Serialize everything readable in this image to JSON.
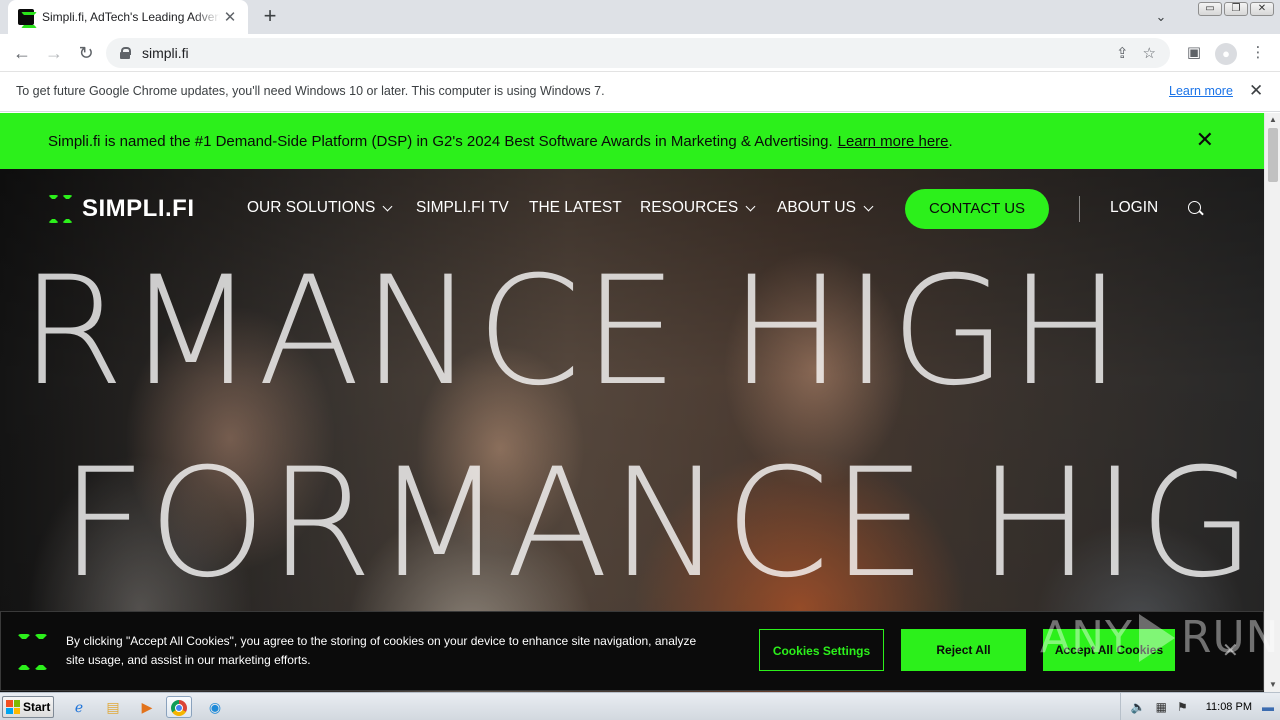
{
  "browser": {
    "tab_title": "Simpli.fi, AdTech's Leading Advertising Platform",
    "tab_close": "✕",
    "new_tab": "+",
    "tab_search": "⌄",
    "url": "simpli.fi",
    "window_controls": [
      "▭",
      "❐",
      "✕"
    ]
  },
  "infobar": {
    "message": "To get future Google Chrome updates, you'll need Windows 10 or later. This computer is using Windows 7.",
    "link": "Learn more",
    "close": "✕"
  },
  "promo": {
    "text": "Simpli.fi is named the #1 Demand-Side Platform (DSP) in G2's 2024 Best Software Awards in Marketing & Advertising.",
    "link": "Learn more here",
    "trailing": ".",
    "close": "✕"
  },
  "site_nav": {
    "logo_text": "SIMPLI.FI",
    "items": [
      {
        "label": "OUR SOLUTIONS",
        "has_dropdown": true
      },
      {
        "label": "SIMPLI.FI TV",
        "has_dropdown": false
      },
      {
        "label": "THE LATEST",
        "has_dropdown": false
      },
      {
        "label": "RESOURCES",
        "has_dropdown": true
      },
      {
        "label": "ABOUT US",
        "has_dropdown": true
      }
    ],
    "contact_label": "CONTACT US",
    "login_label": "LOGIN"
  },
  "hero": {
    "line1": "RMANCE HIGH",
    "line2": "FORMANCE HIG"
  },
  "cookie": {
    "text": "By clicking \"Accept All Cookies\", you agree to the storing of cookies on your device to enhance site navigation, analyze site usage, and assist in our marketing efforts.",
    "settings_label": "Cookies Settings",
    "reject_label": "Reject All",
    "accept_label": "Accept All Cookies",
    "close": "✕"
  },
  "watermark": {
    "left": "ANY",
    "right": "RUN"
  },
  "taskbar": {
    "start_label": "Start",
    "clock": "11:08 PM"
  },
  "colors": {
    "brand_green": "#2cf01b",
    "banner_dark": "#0b0b0b"
  }
}
